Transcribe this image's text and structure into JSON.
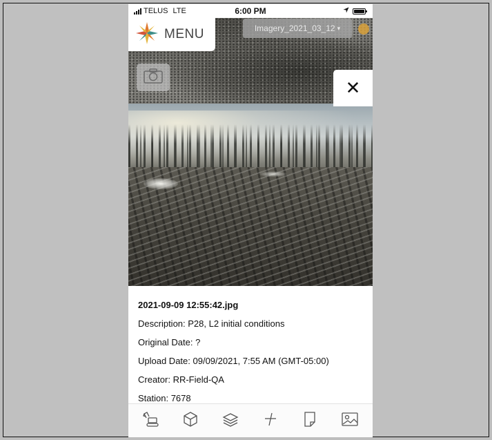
{
  "status_bar": {
    "carrier": "TELUS",
    "network": "LTE",
    "time": "6:00 PM"
  },
  "header": {
    "menu_label": "MENU",
    "imagery_select": "Imagery_2021_03_12",
    "imagery_caret": "▾"
  },
  "popup": {
    "close_label": "✕",
    "filename": "2021-09-09 12:55:42.jpg",
    "description": "Description: P28, L2 initial conditions",
    "original_date": "Original Date: ?",
    "upload_date": "Upload Date: 09/09/2021, 7:55 AM (GMT-05:00)",
    "creator": "Creator: RR-Field-QA",
    "station": "Station: 7678"
  },
  "toolbar": {
    "tools": [
      {
        "icon": "excavator-icon"
      },
      {
        "icon": "cube-icon"
      },
      {
        "icon": "layers-icon"
      },
      {
        "icon": "measure-icon"
      },
      {
        "icon": "note-icon"
      },
      {
        "icon": "image-icon"
      }
    ]
  },
  "colors": {
    "logo_orange": "#e07a2e",
    "logo_teal": "#3e8e8a",
    "logo_yellow": "#e3b43a",
    "icon_gray": "#555555"
  }
}
